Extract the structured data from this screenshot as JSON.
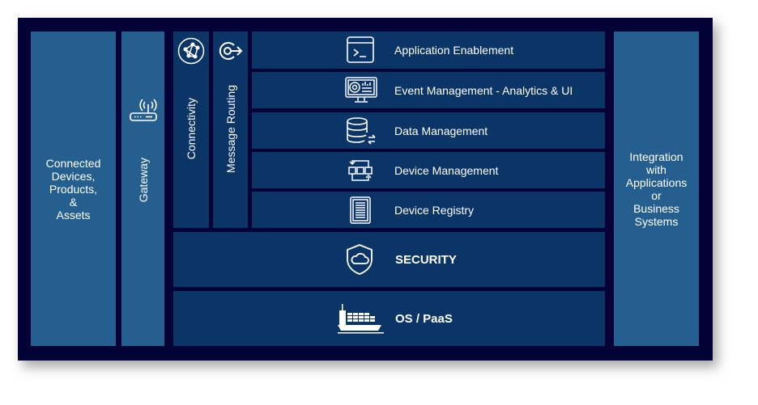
{
  "colors": {
    "background": "#020236",
    "outer_columns": "#255f8f",
    "inner_blocks": "#0b3566",
    "text": "#ffffff"
  },
  "left": {
    "label_lines": [
      "Connected",
      "Devices,",
      "Products,",
      "&",
      "Assets"
    ]
  },
  "gateway": {
    "label": "Gateway",
    "icon": "router-icon"
  },
  "connectivity": {
    "label": "Connectivity",
    "icon": "network-icon"
  },
  "message_routing": {
    "label": "Message Routing",
    "icon": "routing-arrow-icon"
  },
  "layers": [
    {
      "label": "Application Enablement",
      "icon": "terminal-window-icon"
    },
    {
      "label": "Event Management - Analytics & UI",
      "icon": "monitor-dashboard-icon"
    },
    {
      "label": "Data Management",
      "icon": "database-sync-icon"
    },
    {
      "label": "Device Management",
      "icon": "workflow-icon"
    },
    {
      "label": "Device Registry",
      "icon": "list-document-icon"
    }
  ],
  "security": {
    "label": "SECURITY",
    "icon": "shield-cloud-icon"
  },
  "os": {
    "label": "OS / PaaS",
    "icon": "container-ship-icon"
  },
  "right": {
    "label_lines": [
      "Integration",
      "with",
      "Applications",
      "or",
      "Business",
      "Systems"
    ]
  }
}
